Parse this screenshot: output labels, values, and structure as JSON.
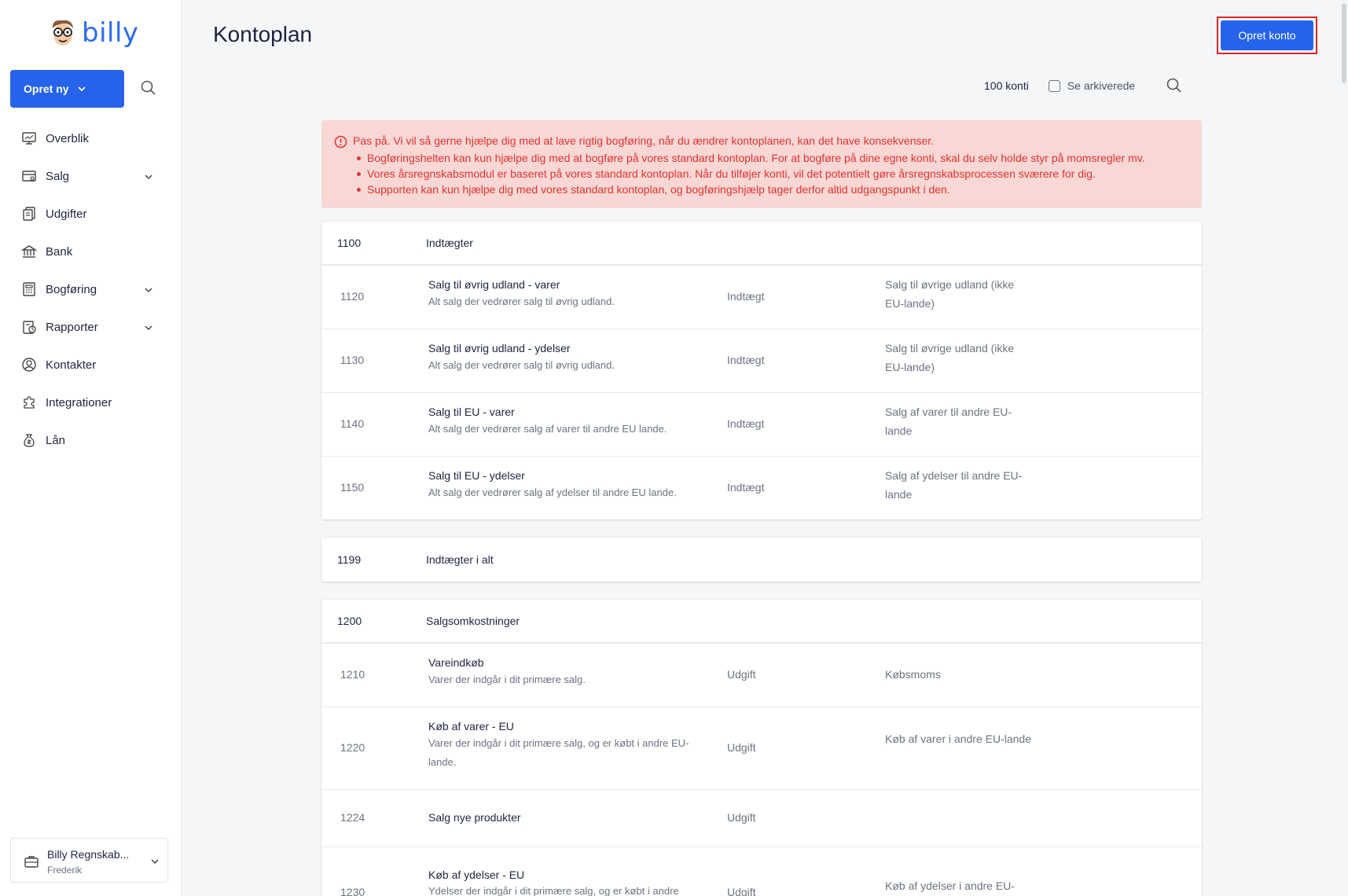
{
  "app": {
    "logo_text": "billy"
  },
  "sidebar": {
    "create_label": "Opret ny",
    "items": [
      {
        "label": "Overblik",
        "icon": "dashboard-icon",
        "expandable": false
      },
      {
        "label": "Salg",
        "icon": "sales-icon",
        "expandable": true
      },
      {
        "label": "Udgifter",
        "icon": "expenses-icon",
        "expandable": false
      },
      {
        "label": "Bank",
        "icon": "bank-icon",
        "expandable": false
      },
      {
        "label": "Bogføring",
        "icon": "bookkeeping-icon",
        "expandable": true
      },
      {
        "label": "Rapporter",
        "icon": "reports-icon",
        "expandable": true
      },
      {
        "label": "Kontakter",
        "icon": "contacts-icon",
        "expandable": false
      },
      {
        "label": "Integrationer",
        "icon": "integrations-icon",
        "expandable": false
      },
      {
        "label": "Lån",
        "icon": "loan-icon",
        "expandable": false
      }
    ],
    "account": {
      "name": "Billy Regnskab...",
      "user": "Frederik"
    }
  },
  "header": {
    "title": "Kontoplan",
    "create_account_label": "Opret konto"
  },
  "toolbar": {
    "count": "100 konti",
    "show_archived": "Se arkiverede"
  },
  "alert": {
    "title": "Pas på. Vi vil så gerne hjælpe dig med at lave rigtig bogføring, når du ændrer kontoplanen, kan det have konsekvenser.",
    "items": [
      "Bogføringshelten kan kun hjælpe dig med at bogføre på vores standard kontoplan. For at bogføre på dine egne konti, skal du selv holde styr på momsregler mv.",
      "Vores årsregnskabsmodul er baseret på vores standard kontoplan. Når du tilføjer konti, vil det potentielt gøre årsregnskabsprocessen sværere for dig.",
      "Supporten kan kun hjælpe dig med vores standard kontoplan, og bogføringshjælp tager derfor altid udgangspunkt i den."
    ]
  },
  "groups": [
    {
      "code": "1100",
      "name": "Indtægter",
      "rows": [
        {
          "code": "1120",
          "name": "Salg til øvrig udland - varer",
          "desc": "Alt salg der vedrører salg til øvrig udland.",
          "type": "Indtægt",
          "vat": "Salg til øvrige udland (ikke EU-lande)"
        },
        {
          "code": "1130",
          "name": "Salg til øvrig udland - ydelser",
          "desc": "Alt salg der vedrører salg til øvrig udland.",
          "type": "Indtægt",
          "vat": "Salg til øvrige udland (ikke EU-lande)"
        },
        {
          "code": "1140",
          "name": "Salg til EU - varer",
          "desc": "Alt salg der vedrører salg af varer til andre EU lande.",
          "type": "Indtægt",
          "vat": "Salg af varer til andre EU-lande"
        },
        {
          "code": "1150",
          "name": "Salg til EU - ydelser",
          "desc": "Alt salg der vedrører salg af ydelser til andre EU lande.",
          "type": "Indtægt",
          "vat": "Salg af ydelser til andre EU-lande"
        }
      ]
    },
    {
      "code": "1199",
      "name": "Indtægter i alt",
      "rows": []
    },
    {
      "code": "1200",
      "name": "Salgsomkostninger",
      "rows": [
        {
          "code": "1210",
          "name": "Vareindkøb",
          "desc": "Varer der indgår i dit primære salg.",
          "type": "Udgift",
          "vat": "Købsmoms"
        },
        {
          "code": "1220",
          "name": "Køb af varer - EU",
          "desc": "Varer der indgår i dit primære salg, og er købt i andre EU-lande.",
          "type": "Udgift",
          "vat": "Køb af varer i andre EU-lande"
        },
        {
          "code": "1224",
          "name": "Salg nye produkter",
          "desc": "",
          "type": "Udgift",
          "vat": ""
        },
        {
          "code": "1230",
          "name": "Køb af ydelser - EU",
          "desc": "Ydelser der indgår i dit primære salg, og er købt i andre",
          "type": "Udgift",
          "vat": "Køb af ydelser i andre EU-"
        }
      ]
    }
  ],
  "colors": {
    "accent": "#2563eb",
    "alert_bg": "#f8d7d5",
    "alert_text": "#e0332f",
    "highlight": "#e02424"
  }
}
